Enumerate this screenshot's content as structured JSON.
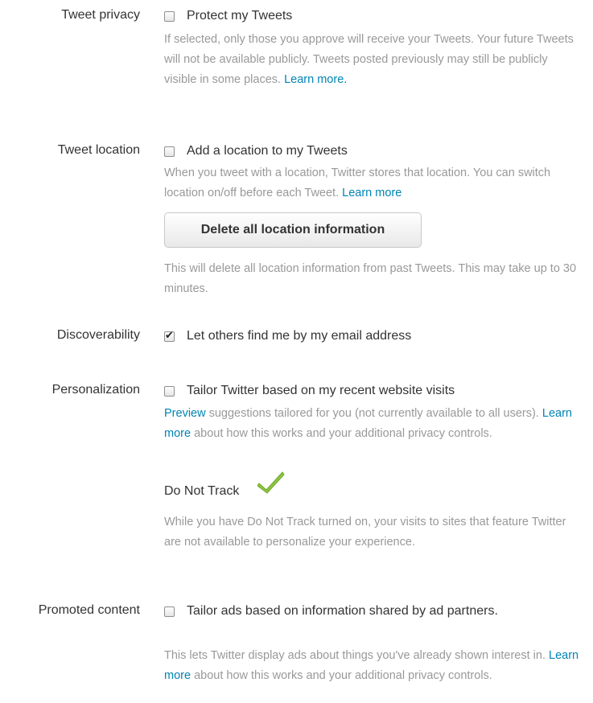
{
  "tweet_privacy": {
    "label": "Tweet privacy",
    "checkbox_label": "Protect my Tweets",
    "checked": false,
    "help": "If selected, only those you approve will receive your Tweets. Your future Tweets will not be available publicly. Tweets posted previously may still be publicly visible in some places.",
    "link": "Learn more."
  },
  "tweet_location": {
    "label": "Tweet location",
    "checkbox_label": "Add a location to my Tweets",
    "checked": false,
    "help": "When you tweet with a location, Twitter stores that location. You can switch location on/off before each Tweet.",
    "link": "Learn more",
    "delete_button": "Delete all location information",
    "delete_help": "This will delete all location information from past Tweets. This may take up to 30 minutes."
  },
  "discoverability": {
    "label": "Discoverability",
    "checkbox_label": "Let others find me by my email address",
    "checked": true
  },
  "personalization": {
    "label": "Personalization",
    "checkbox_label": "Tailor Twitter based on my recent website visits",
    "checked": false,
    "preview_link": "Preview",
    "help_part1": " suggestions tailored for you (not currently available to all users). ",
    "learn_more": "Learn more",
    "help_part2": " about how this works and your additional privacy controls.",
    "dnt_title": "Do Not Track",
    "dnt_help": "While you have Do Not Track turned on, your visits to sites that feature Twitter are not available to personalize your experience."
  },
  "promoted_content": {
    "label": "Promoted content",
    "checkbox_label": "Tailor ads based on information shared by ad partners.",
    "checked": false,
    "help_part1": "This lets Twitter display ads about things you've already shown interest in. ",
    "learn_more": "Learn more",
    "help_part2": " about how this works and your additional privacy controls."
  },
  "colors": {
    "link": "#0084b4",
    "help_text": "#999999",
    "check_icon": "#8cc63f"
  }
}
